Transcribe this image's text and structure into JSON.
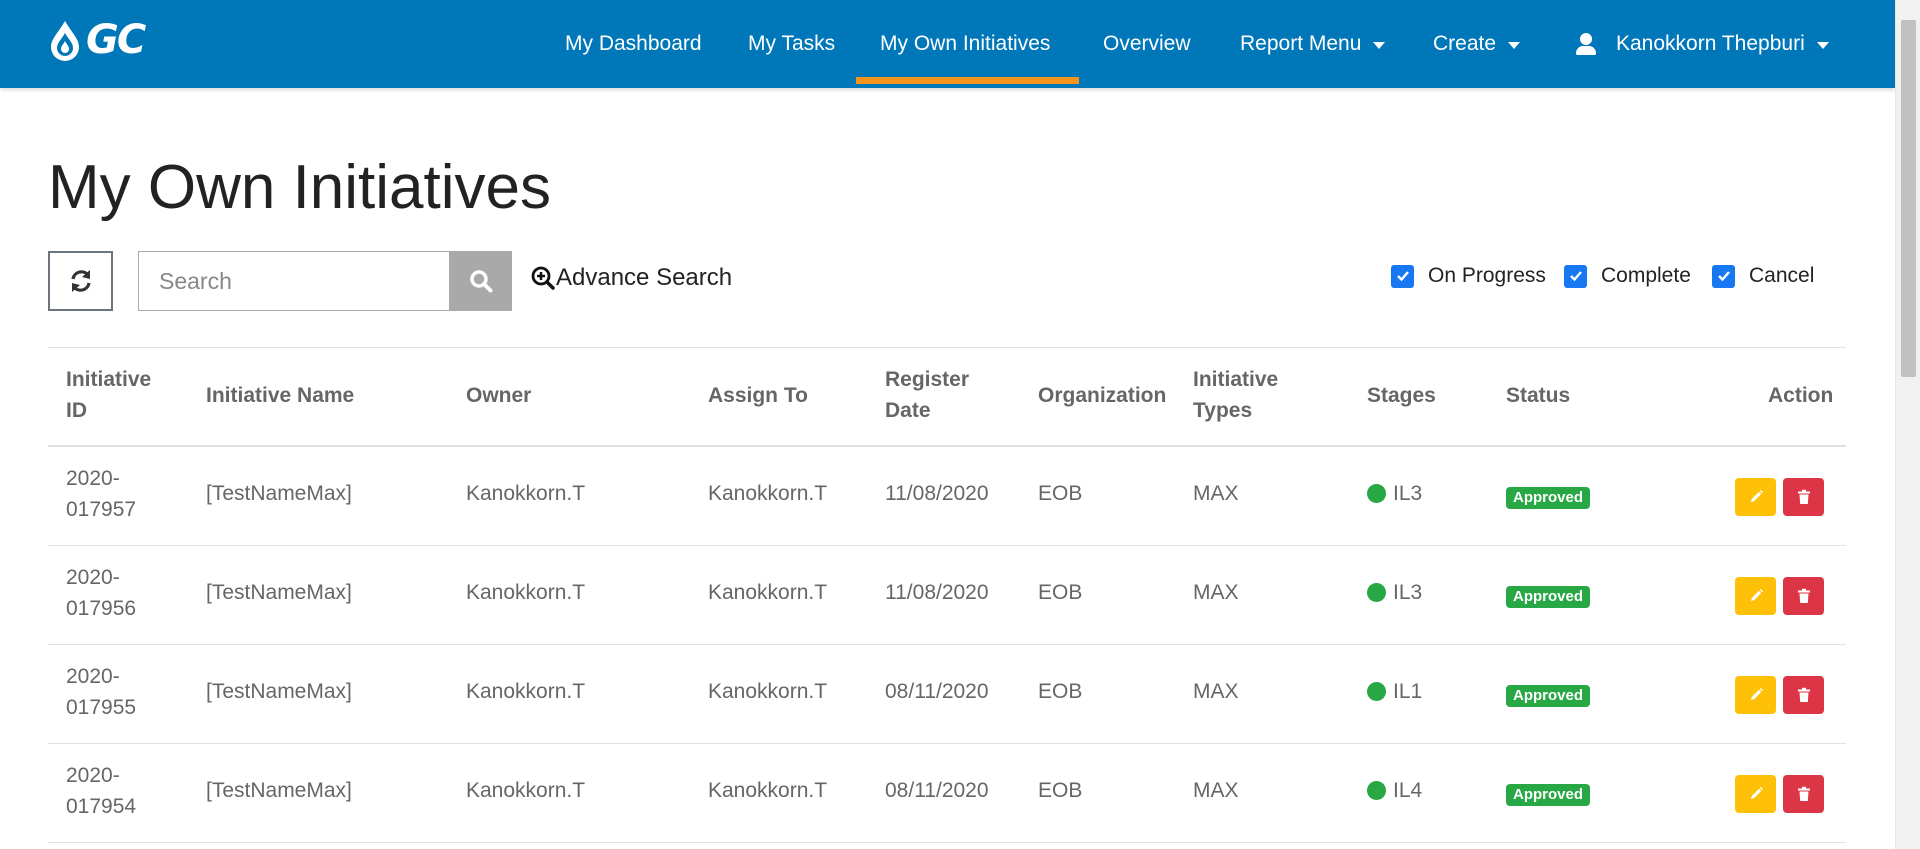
{
  "navbar": {
    "logo": "GC",
    "items": [
      {
        "label": "My Dashboard"
      },
      {
        "label": "My Tasks"
      },
      {
        "label": "My Own Initiatives"
      },
      {
        "label": "Overview"
      },
      {
        "label": "Report Menu"
      },
      {
        "label": "Create"
      }
    ],
    "active_item": "My Own Initiatives",
    "user_name": "Kanokkorn Thepburi",
    "bg_color": "#0077b8",
    "active_accent": "#f7941d"
  },
  "page": {
    "title": "My Own Initiatives"
  },
  "toolbar": {
    "search_placeholder": "Search",
    "advance_search_label": "Advance Search",
    "filters": [
      {
        "label": "On Progress",
        "checked": true
      },
      {
        "label": "Complete",
        "checked": true
      },
      {
        "label": "Cancel",
        "checked": true
      }
    ]
  },
  "table": {
    "headers": {
      "id_l1": "Initiative",
      "id_l2": "ID",
      "name": "Initiative Name",
      "owner": "Owner",
      "assign": "Assign To",
      "date_l1": "Register",
      "date_l2": "Date",
      "org": "Organization",
      "types_l1": "Initiative",
      "types_l2": "Types",
      "stages": "Stages",
      "status": "Status",
      "action": "Action"
    },
    "rows": [
      {
        "id_l1": "2020-",
        "id_l2": "017957",
        "name": "[TestNameMax]",
        "owner": "Kanokkorn.T",
        "assign": "Kanokkorn.T",
        "date": "11/08/2020",
        "org": "EOB",
        "type": "MAX",
        "stage": "IL3",
        "status": "Approved"
      },
      {
        "id_l1": "2020-",
        "id_l2": "017956",
        "name": "[TestNameMax]",
        "owner": "Kanokkorn.T",
        "assign": "Kanokkorn.T",
        "date": "11/08/2020",
        "org": "EOB",
        "type": "MAX",
        "stage": "IL3",
        "status": "Approved"
      },
      {
        "id_l1": "2020-",
        "id_l2": "017955",
        "name": "[TestNameMax]",
        "owner": "Kanokkorn.T",
        "assign": "Kanokkorn.T",
        "date": "08/11/2020",
        "org": "EOB",
        "type": "MAX",
        "stage": "IL1",
        "status": "Approved"
      },
      {
        "id_l1": "2020-",
        "id_l2": "017954",
        "name": "[TestNameMax]",
        "owner": "Kanokkorn.T",
        "assign": "Kanokkorn.T",
        "date": "08/11/2020",
        "org": "EOB",
        "type": "MAX",
        "stage": "IL4",
        "status": "Approved"
      }
    ]
  },
  "icons": {
    "refresh": "refresh-icon",
    "search": "search-icon",
    "advance_search": "zoom-plus-icon",
    "user": "user-icon",
    "edit": "pencil-icon",
    "delete": "trash-icon",
    "checkbox": "check-icon"
  }
}
